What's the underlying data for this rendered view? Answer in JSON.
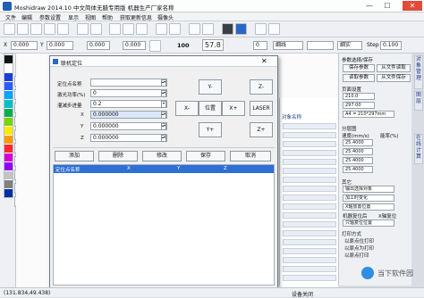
{
  "app": {
    "title": "Moshidraw 2014.10 中文简体无腊专用版 机器生产厂家名称"
  },
  "window": {
    "minimize": "—",
    "maximize": "☐",
    "close": "✕"
  },
  "menu": [
    "文件",
    "编辑",
    "参数设置",
    "显示",
    "视图",
    "帮助",
    "获取更新信息",
    "摄像头"
  ],
  "toolbar2": {
    "x_label": "X",
    "x_value": "0.000",
    "y_label": "Y",
    "y_value": "0.000",
    "w_value": "0.000",
    "h_value": "0.000",
    "lock_count": "100",
    "size_value": "57.8",
    "small_field": "0",
    "line_style_1": "细线",
    "line_style_2": "",
    "line_style_3": "细实",
    "step_label": "Step",
    "step_value": "0.100"
  },
  "palette_colors": [
    "#111111",
    "#ffffff",
    "#1e3fd6",
    "#2b5cff",
    "#00a6ff",
    "#00c0c0",
    "#00b04c",
    "#7cd300",
    "#ffe800",
    "#ff9a00",
    "#ff2a2a",
    "#d400d4",
    "#8e00ff",
    "#c4c4c4",
    "#808080",
    "#0030a0"
  ],
  "dialog": {
    "title": "联机定位",
    "close": "✕",
    "fields": [
      {
        "label": "定位点名称",
        "value": ""
      },
      {
        "label": "激光功率(%)",
        "value": "0"
      },
      {
        "label": "灌减步进量",
        "value": "0.2"
      }
    ],
    "coords": [
      {
        "label": "X",
        "value": "0.000000"
      },
      {
        "label": "Y",
        "value": "0.000000"
      },
      {
        "label": "Z",
        "value": "0.000000"
      }
    ],
    "jog": {
      "y_minus": "Y-",
      "z_minus": "Z-",
      "x_minus": "X-",
      "center": "位置",
      "x_plus": "X+",
      "laser": "LASER",
      "y_plus": "Y+",
      "z_plus": "Z+"
    },
    "actions": [
      "添加",
      "删除",
      "修改",
      "保存",
      "取消"
    ],
    "columns": [
      "定位点名称",
      "X",
      "Y",
      "Z"
    ]
  },
  "right_panel": {
    "section1": "参数选择/保存",
    "btn_save_params": "保存参数",
    "btn_load_from_file": "从文件读取",
    "btn_load_params": "读取参数",
    "btn_save_to_file": "从文件保存",
    "page_label": "页面设置",
    "page_w": "210.0",
    "page_h": "297.00",
    "page_select": "A4 = 210*297mm",
    "table_header": "对象名称",
    "dist_label": "分层图",
    "speed_label": "速度(mm/s)",
    "power_label": "能率(%)",
    "layer_rows": [
      "25.4000",
      "25.4000",
      "25.4000",
      "25.4000"
    ],
    "other_label": "其它",
    "option_sel1": "输出选择对象",
    "option_sel2": "加工时变化",
    "option_sel3": "X轴放置位置",
    "checkbox1": "机器复位后",
    "checkbox2": "X轴复位",
    "option_sel4": "只轴复位位置",
    "print_label": "打印方式",
    "radio1": "以原点位打印",
    "radio2": "以原点为打印",
    "radio3": "以原点打印",
    "vtabs": [
      "对象管理",
      "图层",
      "在线计算"
    ]
  },
  "status": {
    "coords": "(131.834,49.438)",
    "device": "设备关闭"
  },
  "watermark": "当下软件园"
}
